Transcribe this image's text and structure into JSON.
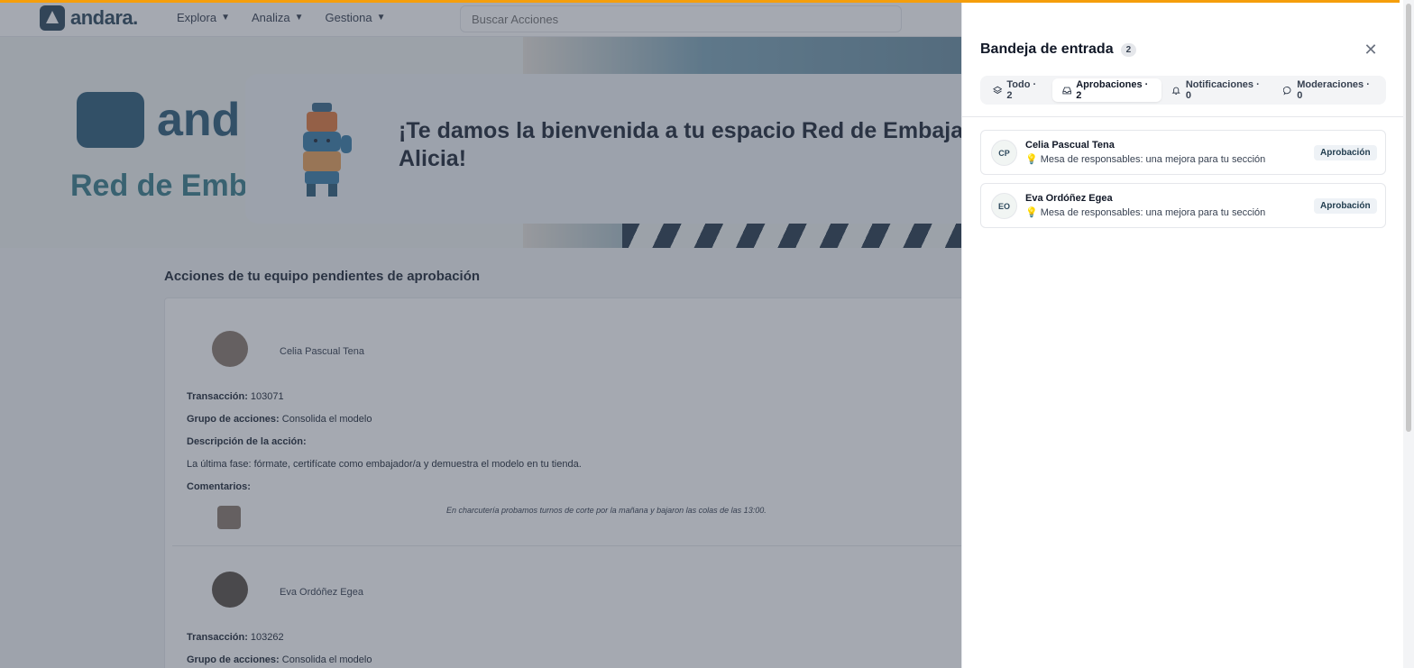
{
  "brand": {
    "logo_text": "andara."
  },
  "nav": {
    "explora": "Explora",
    "analiza": "Analiza",
    "gestiona": "Gestiona"
  },
  "search": {
    "placeholder": "Buscar Acciones"
  },
  "hero": {
    "logo_text": "and",
    "subtitle": "Red de Emba",
    "welcome_line1": "¡Te damos la bienvenida a tu espacio Red de Embajado",
    "welcome_line2": "Alicia!"
  },
  "main": {
    "section_title": "Acciones de tu equipo pendientes de aprobación",
    "labels": {
      "transaction": "Transacción:",
      "group": "Grupo de acciones:",
      "description": "Descripción de la acción:",
      "comments": "Comentarios:"
    },
    "entries": [
      {
        "name": "Celia Pascual Tena",
        "transaction": "103071",
        "group": "Consolida el modelo",
        "description": "La última fase: fórmate, certifícate como embajador/a y demuestra el modelo en tu tienda.",
        "comment": "En charcutería probamos turnos de corte por la mañana y bajaron las colas de las 13:00."
      },
      {
        "name": "Eva Ordóñez Egea",
        "transaction": "103262",
        "group": "Consolida el modelo"
      }
    ]
  },
  "drawer": {
    "title": "Bandeja de entrada",
    "count": "2",
    "close_icon": "close-icon",
    "tabs": [
      {
        "label": "Todo · 2",
        "icon": "layers-icon"
      },
      {
        "label": "Aprobaciones · 2",
        "icon": "inbox-icon"
      },
      {
        "label": "Notificaciones · 0",
        "icon": "bell-icon"
      },
      {
        "label": "Moderaciones · 0",
        "icon": "message-icon"
      }
    ],
    "items": [
      {
        "initials": "CP",
        "name": "Celia Pascual Tena",
        "subtitle": "Mesa de responsables: una mejora para tu sección",
        "badge": "Aprobación"
      },
      {
        "initials": "EO",
        "name": "Eva Ordóñez Egea",
        "subtitle": "Mesa de responsables: una mejora para tu sección",
        "badge": "Aprobación"
      }
    ]
  },
  "colors": {
    "accent": "#f59e0b",
    "brand": "#2f4a5e",
    "overlay": "#374151"
  }
}
